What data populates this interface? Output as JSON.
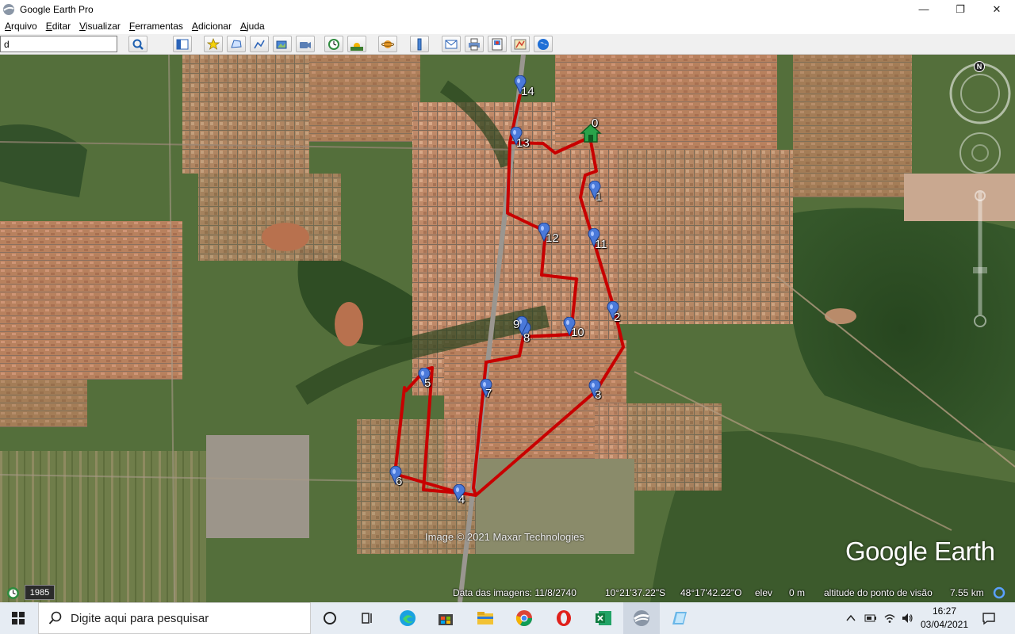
{
  "window": {
    "title": "Google Earth Pro",
    "minimize": "—",
    "maximize": "❐",
    "close": "✕"
  },
  "menu": [
    "Arquivo",
    "Editar",
    "Visualizar",
    "Ferramentas",
    "Adicionar",
    "Ajuda"
  ],
  "search": {
    "value": "d"
  },
  "toolbar_icons": [
    "search-icon",
    "sidebar-toggle-icon",
    "placemark-icon",
    "polygon-icon",
    "path-icon",
    "image-overlay-icon",
    "tour-record-icon",
    "historical-imagery-icon",
    "sunlight-icon",
    "planet-icon",
    "ruler-icon",
    "email-icon",
    "print-icon",
    "save-image-icon",
    "maps-icon",
    "earth-view-icon"
  ],
  "map": {
    "home_label": "0",
    "pins": [
      {
        "label": "1"
      },
      {
        "label": "2"
      },
      {
        "label": "3"
      },
      {
        "label": "4"
      },
      {
        "label": "5"
      },
      {
        "label": "6"
      },
      {
        "label": "7"
      },
      {
        "label": "8"
      },
      {
        "label": "9"
      },
      {
        "label": "10"
      },
      {
        "label": "11"
      },
      {
        "label": "12"
      },
      {
        "label": "13"
      },
      {
        "label": "14"
      }
    ],
    "route_color": "#c80000",
    "credit": "Image © 2021 Maxar Technologies",
    "logo": "Google Earth",
    "compass_label": "N"
  },
  "status": {
    "year": "1985",
    "image_date": "Data das imagens: 11/8/2740",
    "lat": "10°21'37.22\"S",
    "lon": "48°17'42.22\"O",
    "elev_label": "elev",
    "elev_value": "0 m",
    "eye_alt_label": "altitude do ponto de visão",
    "eye_alt_value": "7.55 km"
  },
  "taskbar": {
    "search_placeholder": "Digite aqui para pesquisar",
    "time": "16:27",
    "date": "03/04/2021",
    "apps": [
      "cortana-icon",
      "task-view-icon",
      "edge-icon",
      "store-icon",
      "file-explorer-icon",
      "chrome-icon",
      "opera-icon",
      "excel-icon",
      "google-earth-icon",
      "app-icon"
    ]
  }
}
